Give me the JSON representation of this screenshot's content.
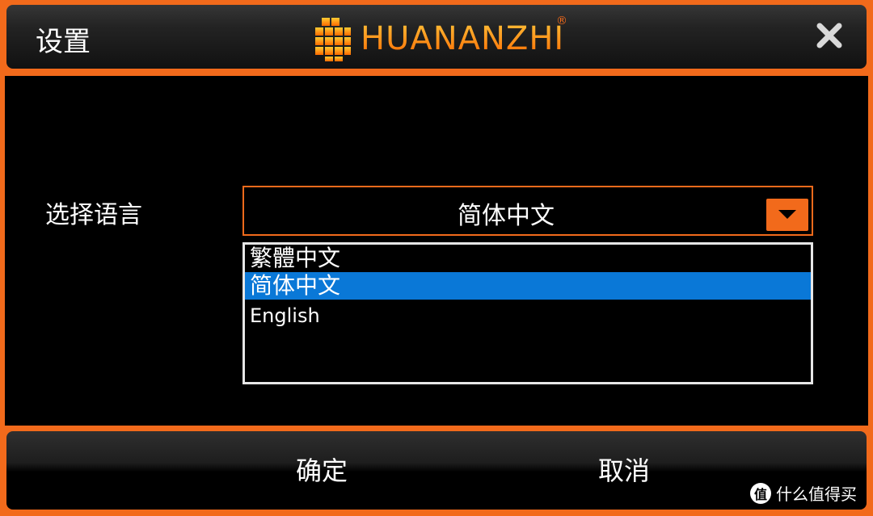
{
  "window": {
    "title": "设置"
  },
  "brand": {
    "name": "HUANANZHI",
    "mark": "®",
    "color": "#f26a1b"
  },
  "icons": {
    "close": "close-icon",
    "dropdown": "caret-down-icon",
    "logo": "cube-logo-icon"
  },
  "language": {
    "label": "选择语言",
    "selected": "简体中文",
    "options": [
      "繁體中文",
      "简体中文",
      "English"
    ],
    "highlight_color": "#0a78d7"
  },
  "footer": {
    "ok_label": "确定",
    "cancel_label": "取消"
  },
  "watermark": {
    "badge": "值",
    "text": "什么值得买"
  }
}
